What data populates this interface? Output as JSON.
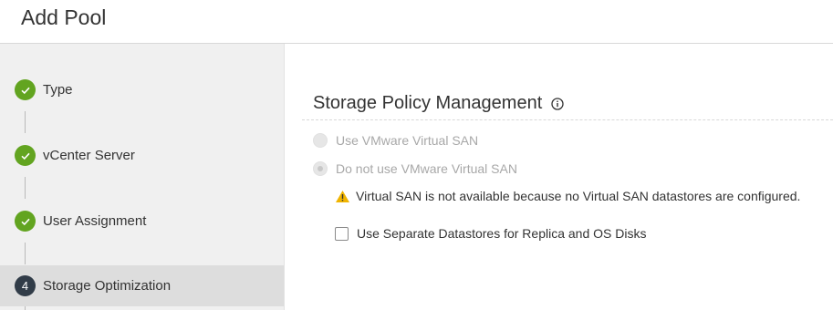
{
  "header": {
    "title": "Add Pool"
  },
  "steps": [
    {
      "label": "Type",
      "status": "done",
      "icon": "check-icon"
    },
    {
      "label": "vCenter Server",
      "status": "done",
      "icon": "check-icon"
    },
    {
      "label": "User Assignment",
      "status": "done",
      "icon": "check-icon"
    },
    {
      "label": "Storage Optimization",
      "status": "current",
      "number": "4"
    }
  ],
  "main": {
    "section_title": "Storage Policy Management",
    "info_icon": "info-icon",
    "radio_use_vsan": "Use VMware Virtual SAN",
    "radio_no_vsan": "Do not use VMware Virtual SAN",
    "warning_text": "Virtual SAN is not available because no Virtual SAN datastores are configured.",
    "checkbox_separate": "Use Separate Datastores for Replica and OS Disks"
  },
  "colors": {
    "done": "#62a420",
    "current": "#313c48",
    "warning": "#f0b400"
  }
}
